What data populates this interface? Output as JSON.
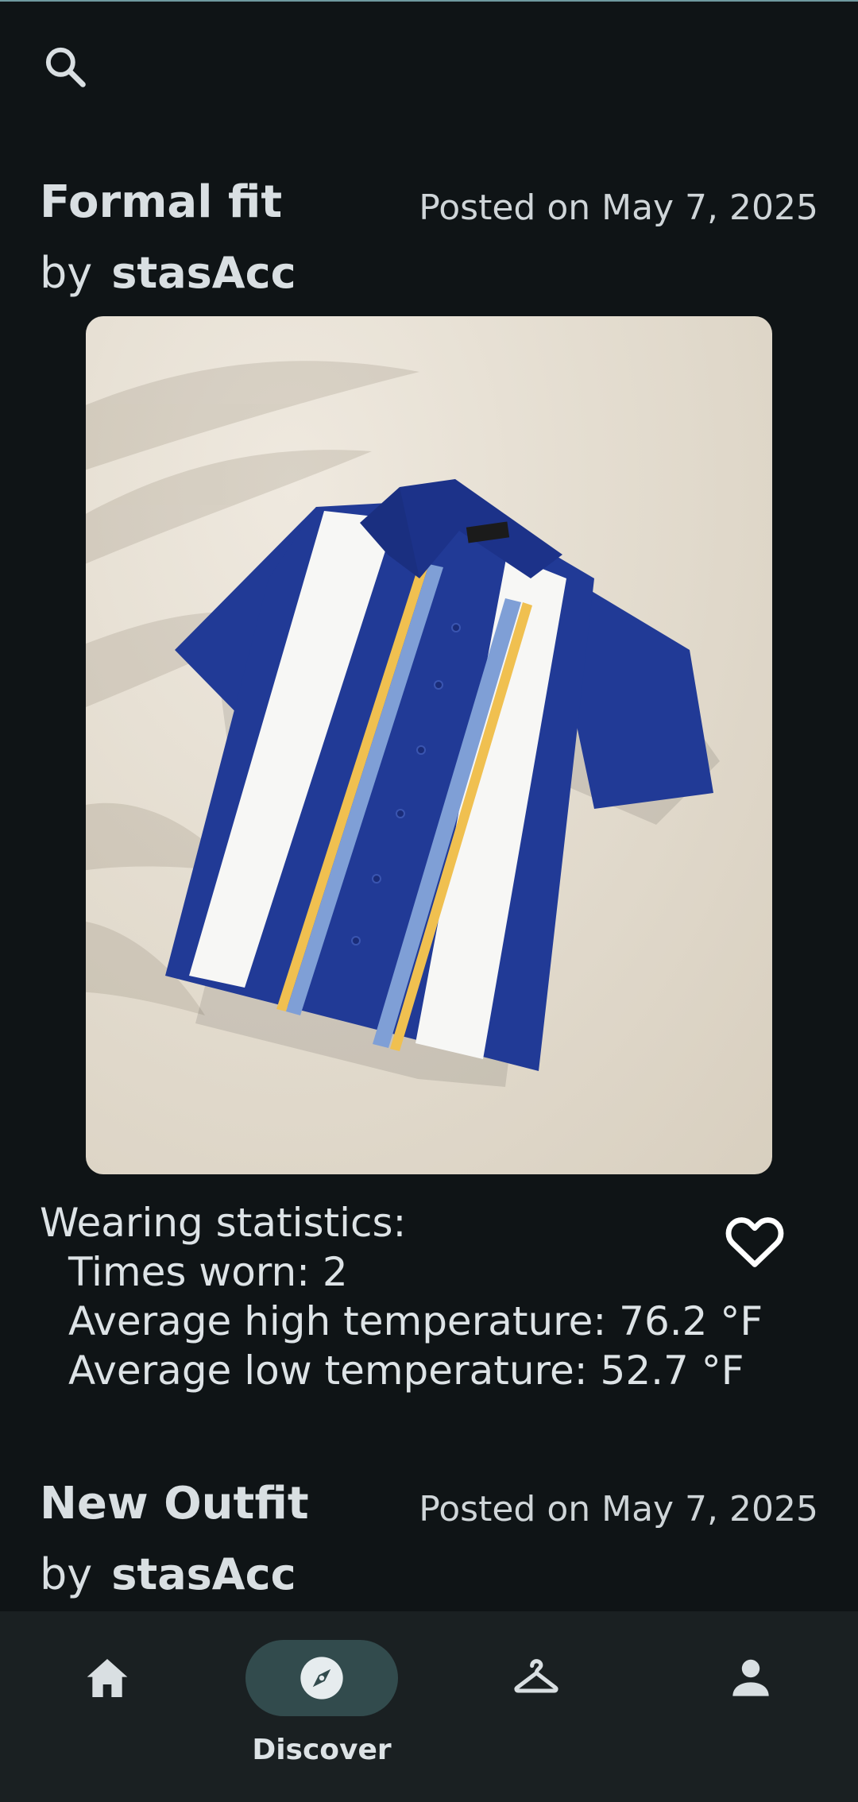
{
  "search": {
    "icon": "search-icon"
  },
  "posts": [
    {
      "title": "Formal fit",
      "date": "Posted on May 7, 2025",
      "by_label": "by",
      "author": "stasAcc",
      "stats": {
        "heading": "Wearing statistics:",
        "times_worn": "Times worn: 2",
        "avg_high": "Average high temperature: 76.2 °F",
        "avg_low": "Average low temperature: 52.7 °F"
      },
      "liked": false
    },
    {
      "title": "New Outfit",
      "date": "Posted on May 7, 2025",
      "by_label": "by",
      "author": "stasAcc"
    }
  ],
  "nav": {
    "items": [
      {
        "icon": "home-icon",
        "label": ""
      },
      {
        "icon": "compass-icon",
        "label": "Discover",
        "active": true
      },
      {
        "icon": "hanger-icon",
        "label": ""
      },
      {
        "icon": "person-icon",
        "label": ""
      }
    ]
  },
  "colors": {
    "background": "#0f1416",
    "nav_background": "#1a2022",
    "nav_active_pill": "#324b4d",
    "text": "#dde3e6",
    "shirt_blue": "#213a96",
    "shirt_stripe_yellow": "#f0c050",
    "shirt_stripe_lightblue": "#7f9fd6"
  }
}
